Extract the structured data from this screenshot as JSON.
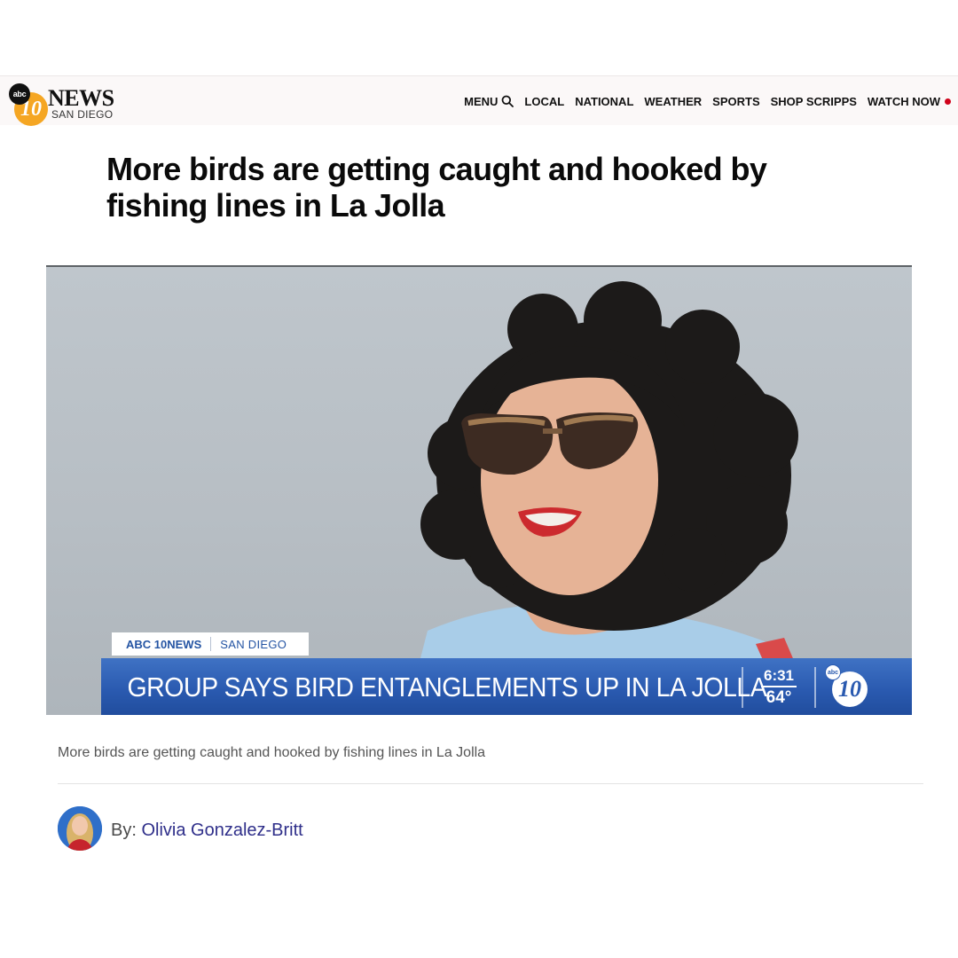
{
  "header": {
    "logo": {
      "abc_text": "abc",
      "ten_text": "10",
      "wordmark": "NEWS",
      "subword": "SAN DIEGO"
    },
    "nav": {
      "menu_label": "MENU",
      "items": [
        "LOCAL",
        "NATIONAL",
        "WEATHER",
        "SPORTS",
        "SHOP SCRIPPS"
      ],
      "watch_label": "WATCH NOW"
    }
  },
  "article": {
    "headline": "More birds are getting caught and hooked by fishing lines in La Jolla",
    "video": {
      "lower_third": {
        "brand": "ABC 10NEWS",
        "city": "SAN DIEGO",
        "headline": "GROUP SAYS BIRD ENTANGLEMENTS UP IN LA JOLLA",
        "time": "6:31",
        "temperature": "64°",
        "logo_abc": "abc",
        "logo_ten": "10"
      }
    },
    "caption": "More birds are getting caught and hooked by fishing lines in La Jolla",
    "byline": {
      "prefix": "By: ",
      "author": "Olivia Gonzalez-Britt"
    }
  },
  "colors": {
    "accent_blue": "#2a5ab0",
    "live_red": "#d0021b",
    "logo_orange": "#f5a623",
    "author_link": "#2f2f8a"
  }
}
